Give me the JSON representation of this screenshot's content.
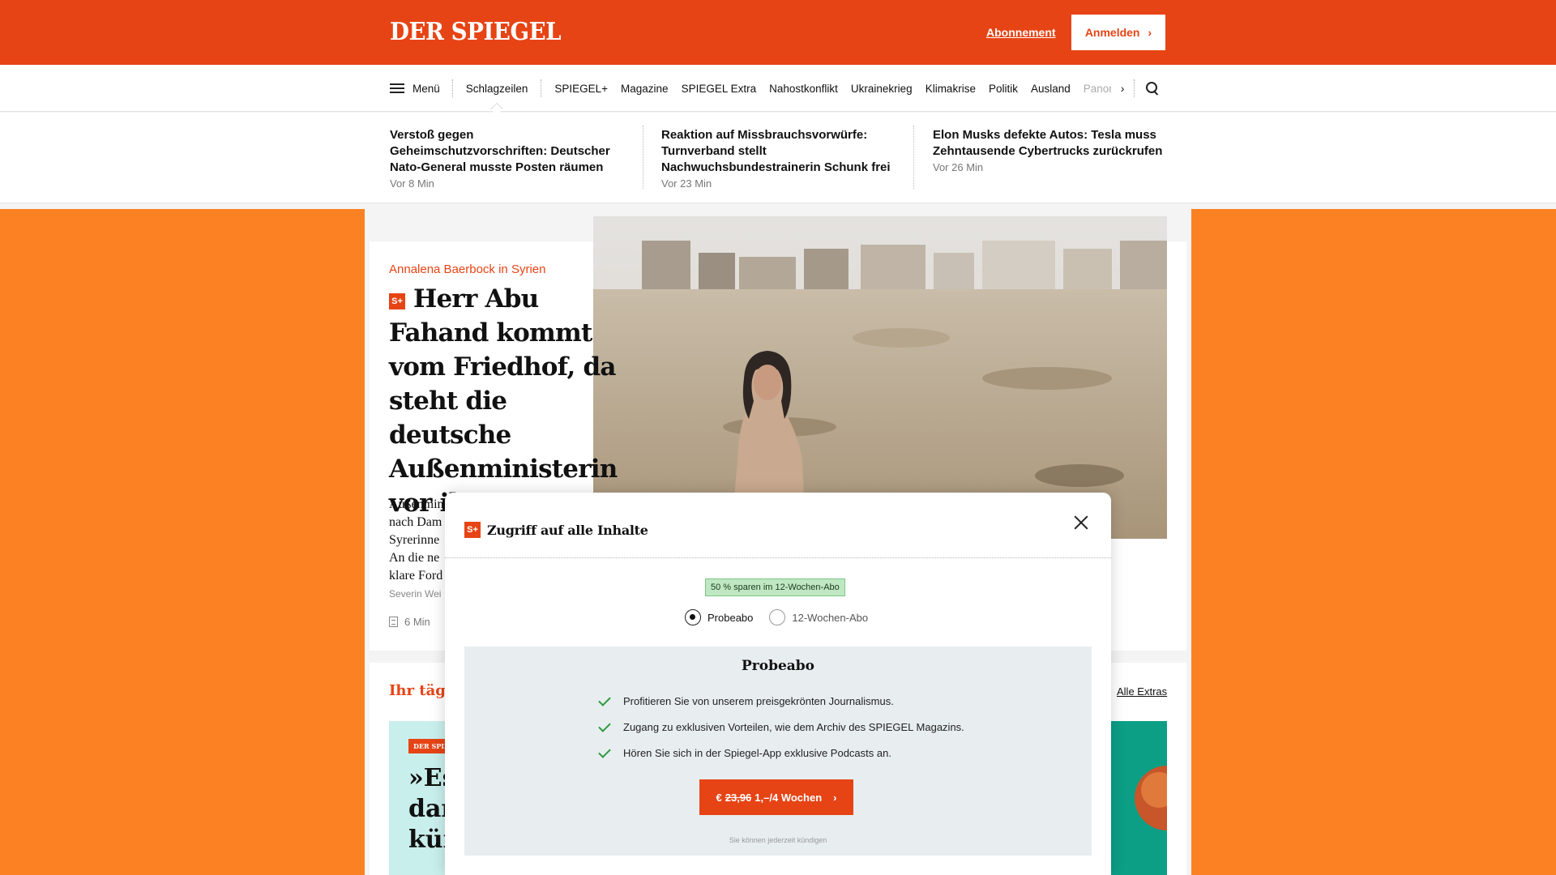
{
  "header": {
    "logo": "DER SPIEGEL",
    "abo_label": "Abonnement",
    "login_label": "Anmelden",
    "accent_color": "#e64415"
  },
  "nav": {
    "menu_label": "Menü",
    "active_item": "Schlagzeilen",
    "items": [
      "SPIEGEL+",
      "Magazine",
      "SPIEGEL Extra",
      "Nahostkonflikt",
      "Ukrainekrieg",
      "Klimakrise",
      "Politik",
      "Ausland"
    ],
    "faded_item": "Panor"
  },
  "ticker": [
    {
      "title": "Verstoß gegen Geheimschutzvorschriften: Deutscher Nato-General musste Posten räumen",
      "time": "Vor 8 Min"
    },
    {
      "title": "Reaktion auf Missbrauchsvorwürfe: Turnverband stellt Nachwuchsbundestrainerin Schunk frei",
      "time": "Vor 23 Min"
    },
    {
      "title": "Elon Musks defekte Autos: Tesla muss Zehntausende Cybertrucks zurückrufen",
      "time": "Vor 26 Min"
    }
  ],
  "article": {
    "kicker": "Annalena Baerbock in Syrien",
    "plus_badge": "S+",
    "headline": "Herr Abu Fahand kommt vom Friedhof, da steht die deutsche Außenministerin vor ihm",
    "teaser_lines": [
      "Außenmin",
      "nach Dam",
      "Syrerinne",
      "An die ne",
      "klare Ford"
    ],
    "author": "Severin Wei",
    "read_time": "6 Min"
  },
  "extras": {
    "title": "Ihr täglic",
    "link": "Alle Extras",
    "badge": "DER SPIEGEL",
    "quote_lines": [
      "»Es",
      "dar",
      "kün"
    ]
  },
  "modal": {
    "title": "Zugriff auf alle Inhalte",
    "save_badge": "50 % sparen im 12-Wochen-Abo",
    "options": [
      "Probeabo",
      "12-Wochen-Abo"
    ],
    "selected_option": "Probeabo",
    "plan_title": "Probeabo",
    "benefits": [
      "Profitieren Sie von unserem preisgekrönten Journalismus.",
      "Zugang zu exklusiven Vorteilen, wie dem Archiv des SPIEGEL Magazins.",
      "Hören Sie sich in der Spiegel-App exklusive Podcasts an."
    ],
    "cta_prefix": "€",
    "cta_old_price": "23,96",
    "cta_new_price": "1,–/4 Wochen",
    "cancel_note": "Sie können jederzeit kündigen"
  }
}
